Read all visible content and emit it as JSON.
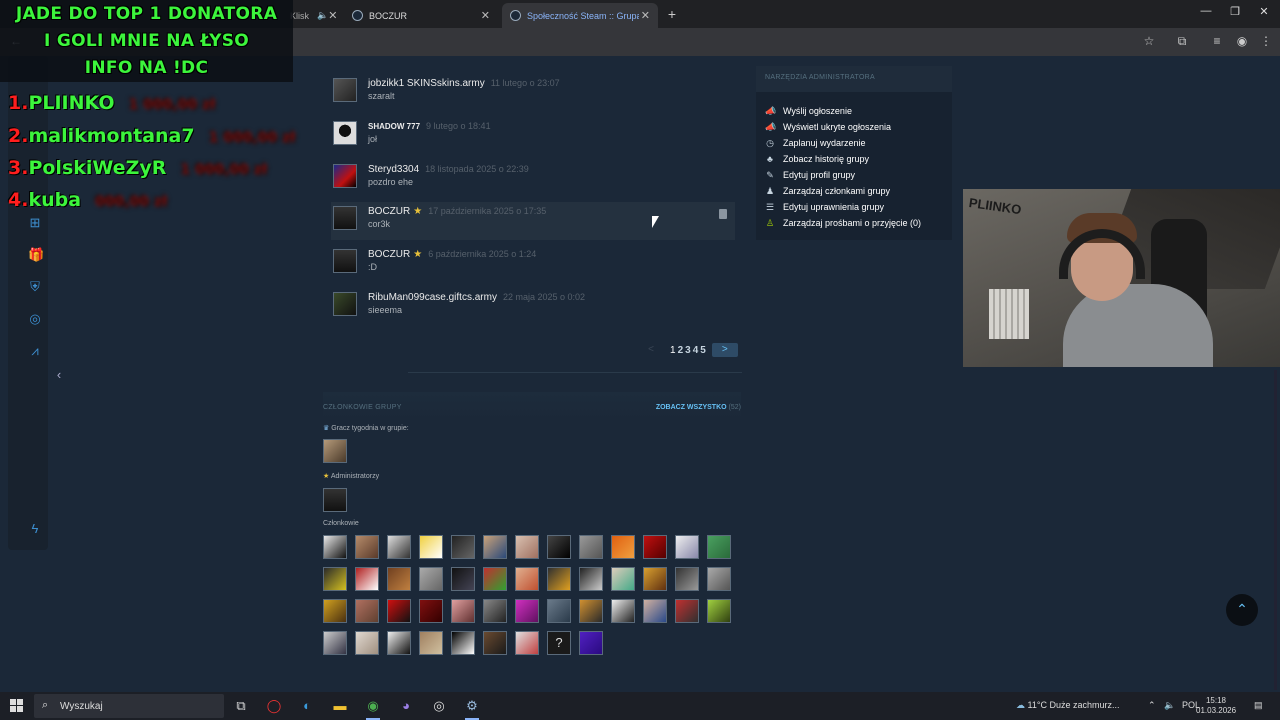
{
  "browser": {
    "tabs": [
      {
        "title": "Klisk",
        "active": false
      },
      {
        "title": "BOCZUR",
        "active": false
      },
      {
        "title": "Społeczność Steam :: Grupa :: B",
        "active": true
      }
    ]
  },
  "overlay": {
    "lines": [
      "JADE DO TOP 1 DONATORA",
      "I GOLI MNIE NA ŁYSO",
      "INFO NA !DC"
    ],
    "donors": [
      {
        "rank": "1.",
        "name": "PLIINKO",
        "amount": "1 000,00 zł"
      },
      {
        "rank": "2.",
        "name": "malikmontana7",
        "amount": "1 000,00 zł"
      },
      {
        "rank": "3.",
        "name": "PolskiWeZyR",
        "amount": "1 000,00 zł"
      },
      {
        "rank": "4.",
        "name": "kuba",
        "amount": "000,00 zł"
      }
    ]
  },
  "comments": [
    {
      "author": "jobzikk1 SKINSskins.army",
      "date": "11 lutego o 23:07",
      "text": "szaralt",
      "star": false
    },
    {
      "author": "SHADOW 777",
      "date": "9 lutego o 18:41",
      "text": "joł",
      "star": false
    },
    {
      "author": "Steryd3304",
      "date": "18 listopada 2025 o 22:39",
      "text": "pozdro ehe",
      "star": false
    },
    {
      "author": "BOCZUR",
      "date": "17 października 2025 o 17:35",
      "text": "cor3k",
      "star": true
    },
    {
      "author": "BOCZUR",
      "date": "6 października 2025 o 1:24",
      "text": ":D",
      "star": true
    },
    {
      "author": "RibuMan099case.giftcs.army",
      "date": "22 maja 2025 o 0:02",
      "text": "sieeema",
      "star": false
    }
  ],
  "pagination": {
    "prev": "<",
    "pages": [
      "1",
      "2",
      "3",
      "4",
      "5"
    ],
    "current": "1",
    "next": ">"
  },
  "members": {
    "title": "CZŁONKOWIE GRUPY",
    "see_all": "ZOBACZ WSZYSTKO",
    "count": "(52)",
    "player_of_week": "Gracz tygodnia w grupie:",
    "admins": "Administratorzy",
    "members": "Członkowie",
    "unknown_avatar": "?"
  },
  "admin_tools": {
    "title": "NARZĘDZIA ADMINISTRATORA",
    "items": [
      {
        "label": "Wyślij ogłoszenie",
        "icon": "megaphone-icon"
      },
      {
        "label": "Wyświetl ukryte ogłoszenia",
        "icon": "megaphone-icon"
      },
      {
        "label": "Zaplanuj wydarzenie",
        "icon": "clock-icon"
      },
      {
        "label": "Zobacz historię grupy",
        "icon": "group-icon"
      },
      {
        "label": "Edytuj profil grupy",
        "icon": "pencil-icon"
      },
      {
        "label": "Zarządzaj członkami grupy",
        "icon": "people-icon"
      },
      {
        "label": "Edytuj uprawnienia grupy",
        "icon": "list-icon"
      },
      {
        "label": "Zarządzaj prośbami o przyjęcie (0)",
        "icon": "user-add-icon"
      }
    ]
  },
  "taskbar": {
    "search_placeholder": "Wyszukaj",
    "weather": "11°C  Duże zachmurz...",
    "lang": "POL",
    "time": "15:18",
    "date": "01.03.2026"
  },
  "colors": {
    "accent": "#66c0f4",
    "background": "#1b2838",
    "overlay_green": "#3cf53c",
    "overlay_red": "#ff1e1e"
  }
}
